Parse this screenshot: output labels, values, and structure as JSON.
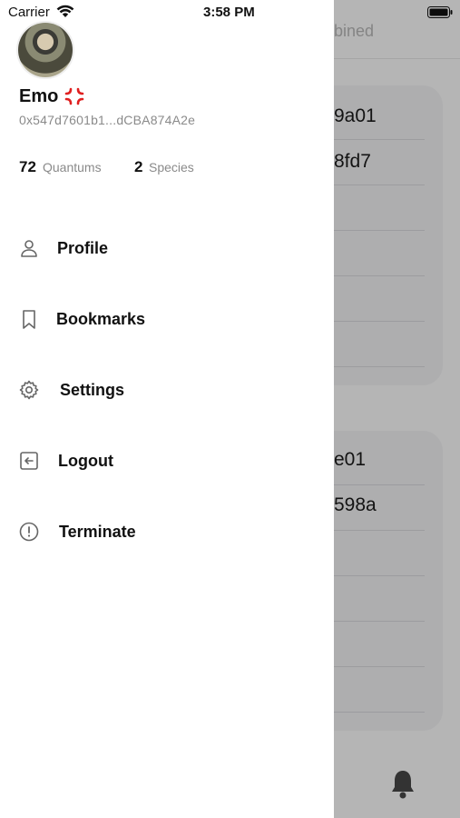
{
  "status_bar": {
    "carrier": "Carrier",
    "time": "3:58 PM"
  },
  "background": {
    "tab_label_fragment": "bined",
    "card1": {
      "rows": [
        "9a01",
        "8fd7"
      ]
    },
    "card2": {
      "rows": [
        "e01",
        "598a"
      ]
    }
  },
  "drawer": {
    "user": {
      "name": "Emo",
      "address": "0x547d7601b1...dCBA874A2e"
    },
    "stats": [
      {
        "value": "72",
        "label": "Quantums"
      },
      {
        "value": "2",
        "label": "Species"
      }
    ],
    "menu": [
      {
        "label": "Profile",
        "icon": "person-icon"
      },
      {
        "label": "Bookmarks",
        "icon": "bookmark-icon"
      },
      {
        "label": "Settings",
        "icon": "gear-icon"
      },
      {
        "label": "Logout",
        "icon": "logout-icon"
      },
      {
        "label": "Terminate",
        "icon": "alert-circle-icon"
      }
    ]
  }
}
